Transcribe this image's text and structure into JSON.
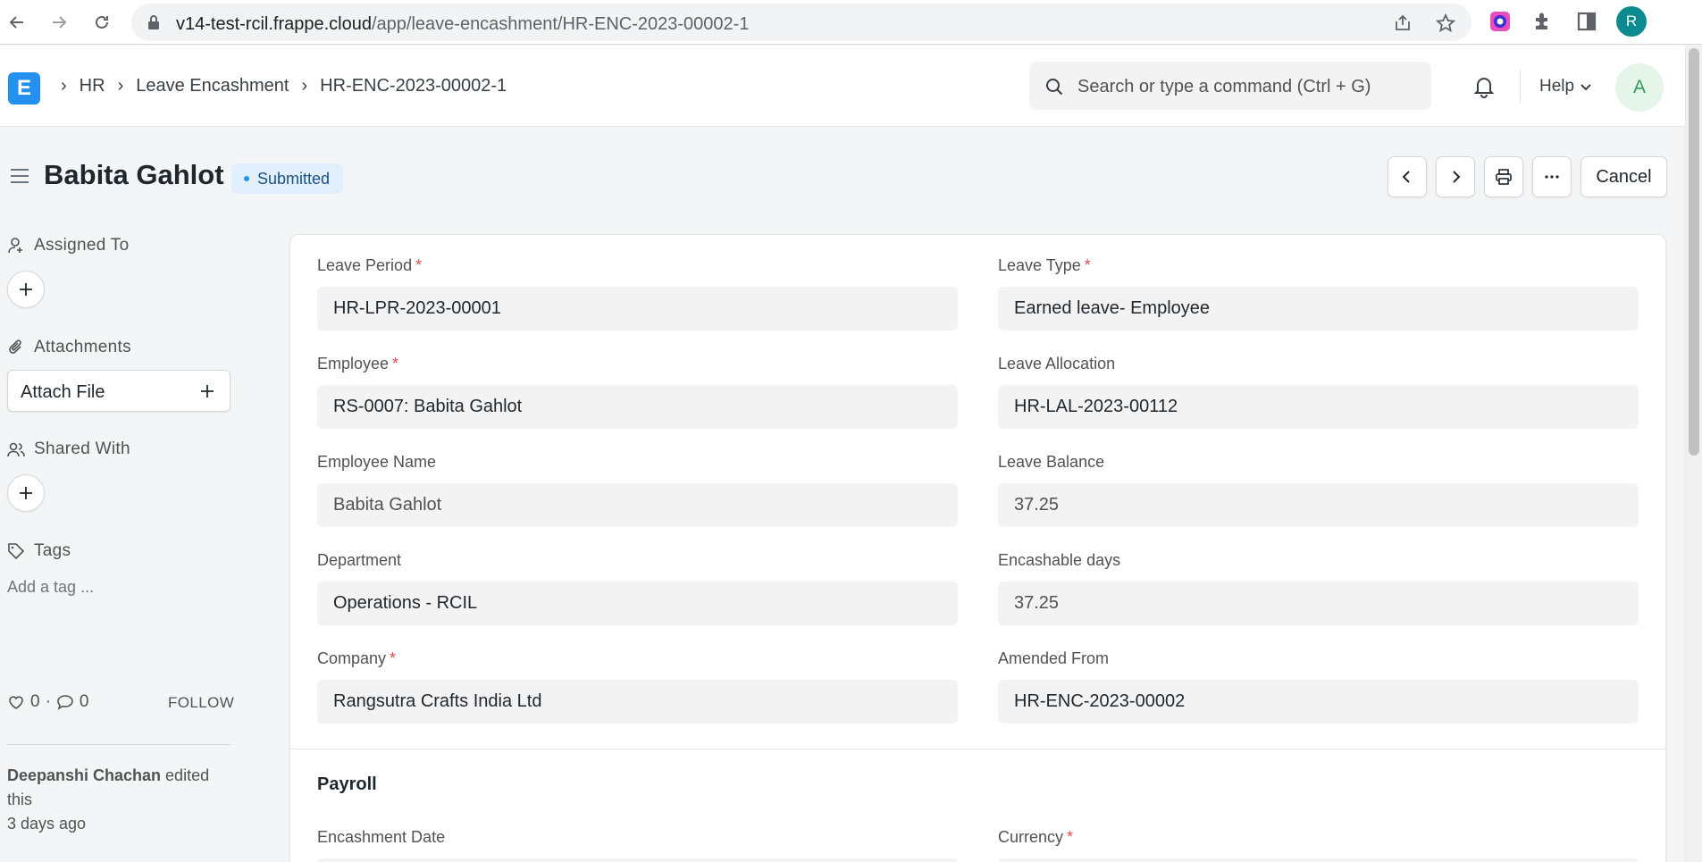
{
  "browser": {
    "url_host": "v14-test-rcil.frappe.cloud",
    "url_path": "/app/leave-encashment/HR-ENC-2023-00002-1",
    "profile_initial": "R"
  },
  "navbar": {
    "breadcrumbs": [
      "HR",
      "Leave Encashment",
      "HR-ENC-2023-00002-1"
    ],
    "search_placeholder": "Search or type a command (Ctrl + G)",
    "help_label": "Help",
    "avatar_initial": "A"
  },
  "page": {
    "title": "Babita Gahlot",
    "status": "Submitted",
    "cancel_label": "Cancel"
  },
  "sidebar": {
    "assigned_to": "Assigned To",
    "attachments": "Attachments",
    "attach_file": "Attach File",
    "shared_with": "Shared With",
    "tags": "Tags",
    "add_tag": "Add a tag ...",
    "likes": "0",
    "comments": "0",
    "follow": "FOLLOW",
    "activity_user": "Deepanshi Chachan",
    "activity_text": " edited this",
    "activity_time": "3 days ago"
  },
  "form": {
    "fields": [
      {
        "label": "Leave Period",
        "required": "*",
        "value": "HR-LPR-2023-00001"
      },
      {
        "label": "Leave Type",
        "required": "*",
        "value": "Earned leave- Employee"
      },
      {
        "label": "Employee",
        "required": "*",
        "value": "RS-0007: Babita Gahlot"
      },
      {
        "label": "Leave Allocation",
        "required": "",
        "value": "HR-LAL-2023-00112"
      },
      {
        "label": "Employee Name",
        "required": "",
        "value": "Babita Gahlot"
      },
      {
        "label": "Leave Balance",
        "required": "",
        "value": "37.25"
      },
      {
        "label": "Department",
        "required": "",
        "value": "Operations - RCIL"
      },
      {
        "label": "Encashable days",
        "required": "",
        "value": "37.25"
      },
      {
        "label": "Company",
        "required": "*",
        "value": "Rangsutra Crafts India Ltd"
      },
      {
        "label": "Amended From",
        "required": "",
        "value": "HR-ENC-2023-00002"
      }
    ],
    "section_title": "Payroll",
    "payroll_fields": [
      {
        "label": "Encashment Date",
        "required": ""
      },
      {
        "label": "Currency",
        "required": "*"
      }
    ]
  }
}
